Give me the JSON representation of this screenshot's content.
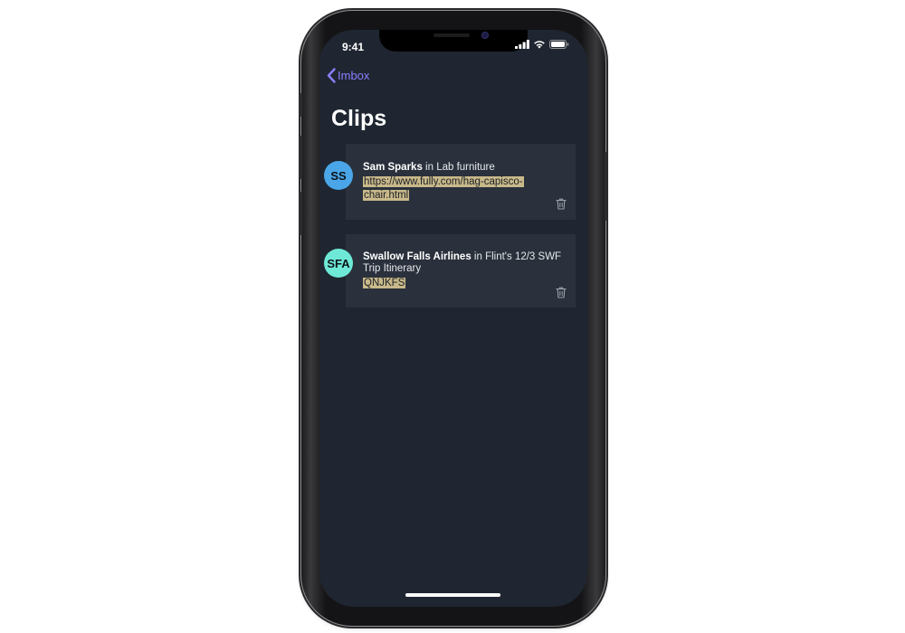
{
  "status_bar": {
    "time": "9:41",
    "icons": [
      "cellular-signal-icon",
      "wifi-icon",
      "battery-icon"
    ]
  },
  "nav": {
    "back_label": "Imbox",
    "back_icon": "chevron-left-icon"
  },
  "page": {
    "title": "Clips"
  },
  "clips": [
    {
      "avatar_initials": "SS",
      "avatar_color": "#4aa6e8",
      "sender": "Sam Sparks",
      "context": " in Lab furniture",
      "clip_lines": [
        "https://www.fully.com/hag-capisco-",
        "chair.html"
      ],
      "delete_icon": "trash-icon"
    },
    {
      "avatar_initials": "SFA",
      "avatar_color": "#6ee9d8",
      "sender": "Swallow Falls Airlines",
      "context": " in Flint's 12/3 SWF Trip Itinerary",
      "clip_lines": [
        "QNJKFS"
      ],
      "delete_icon": "trash-icon"
    }
  ],
  "colors": {
    "screen_background": "#1f2631",
    "card_background": "#2a313c",
    "accent": "#8d7dff",
    "clip_highlight": "#c9b98a"
  }
}
